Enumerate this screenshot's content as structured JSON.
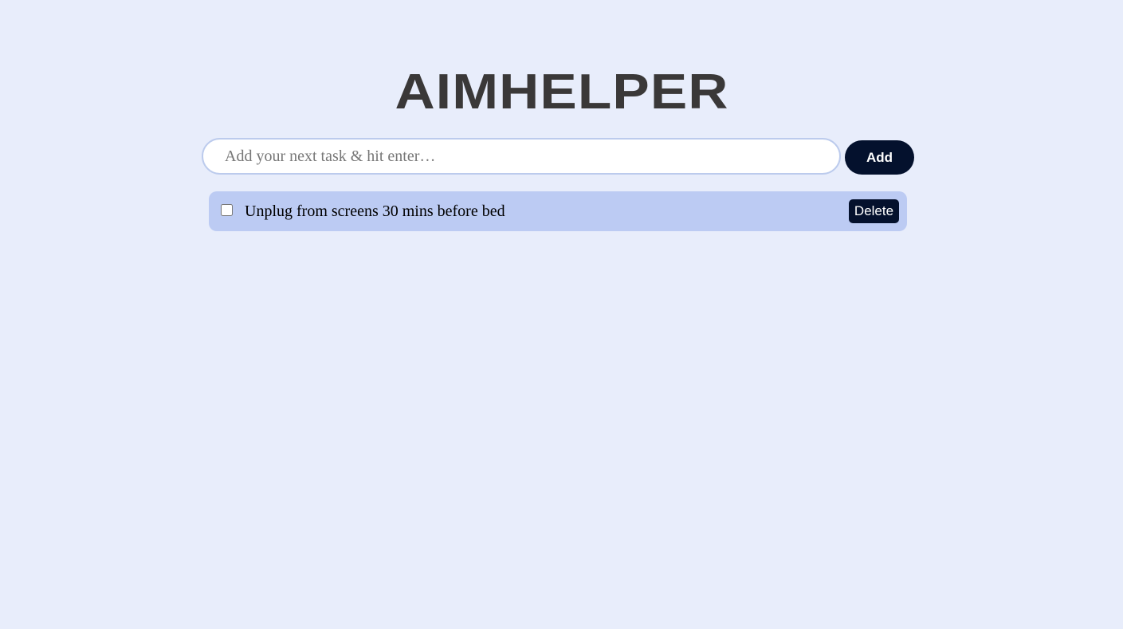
{
  "app": {
    "title": "AIMHELPER"
  },
  "task_form": {
    "input_value": "",
    "input_placeholder": "Add your next task & hit enter…",
    "add_label": "Add"
  },
  "tasks": [
    {
      "text": "Unplug from screens 30 mins before bed",
      "completed": false,
      "delete_label": "Delete"
    }
  ],
  "colors": {
    "background": "#e8edfb",
    "title": "#3a3838",
    "input_border": "#bccbed",
    "button_dark": "#04112d",
    "task_background": "#bccbf3"
  }
}
